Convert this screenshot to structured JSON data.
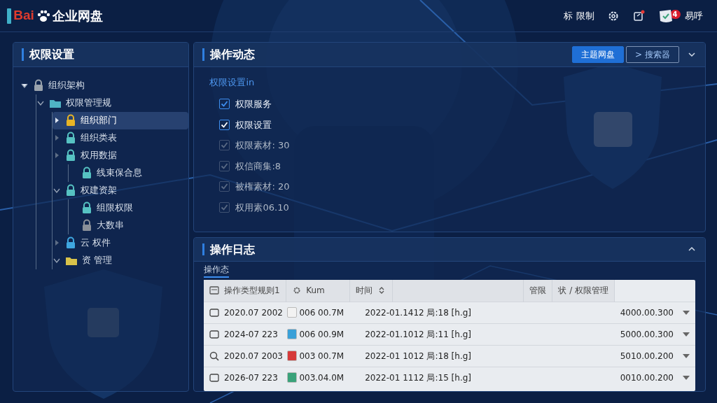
{
  "header": {
    "logo_text": "Bai",
    "product": "企业网盘",
    "links": [
      {
        "kind": "text",
        "label": "标 限制"
      },
      {
        "kind": "gear"
      },
      {
        "kind": "export"
      }
    ],
    "user": {
      "name": "易呼",
      "badge": "4"
    }
  },
  "sidebar": {
    "title": "权限设置",
    "tree": [
      {
        "label": "组织架构",
        "kind": "lock",
        "color": "#9aa3ad",
        "expanded": true,
        "selected": false,
        "children": [
          {
            "label": "权限管理规",
            "kind": "folder",
            "color": "#4fb3c4",
            "expanded": true,
            "selected": false,
            "children": [
              {
                "label": "组织部门",
                "kind": "lock",
                "color": "#e8b425",
                "expanded": false,
                "selected": true
              },
              {
                "label": "组织类表",
                "kind": "lock",
                "color": "#56c2c2",
                "expanded": false,
                "selected": false
              },
              {
                "label": "权用数据",
                "kind": "lock",
                "color": "#56c2c2",
                "expanded": false,
                "selected": false,
                "children": [
                  {
                    "label": "线束保合息",
                    "kind": "lock",
                    "color": "#56c2c2",
                    "selected": false
                  }
                ]
              },
              {
                "label": "权建资架",
                "kind": "lock",
                "color": "#56c2c2",
                "expanded": true,
                "selected": false,
                "children": [
                  {
                    "label": "组限权限",
                    "kind": "lock",
                    "color": "#56c2c2",
                    "selected": false
                  },
                  {
                    "label": "大数串",
                    "kind": "lock",
                    "color": "#8a9099",
                    "selected": false
                  }
                ]
              },
              {
                "label": "云 权件",
                "kind": "lock",
                "color": "#3fa7e0",
                "expanded": false,
                "selected": false
              },
              {
                "label": "资 管理",
                "kind": "folder",
                "color": "#d8c24a",
                "expanded": true,
                "selected": false
              }
            ]
          }
        ]
      }
    ]
  },
  "activity": {
    "title": "操作动态",
    "buttons": [
      {
        "label": "主题网盘",
        "kind": "primary"
      },
      {
        "label": "> 搜索器",
        "kind": "outline"
      }
    ],
    "subtitle": "权限设置in",
    "options": [
      {
        "label": "权限服务",
        "checked": true,
        "disabled": false
      },
      {
        "label": "权限设置",
        "checked": true,
        "disabled": false
      },
      {
        "label": "权限素材: 30",
        "checked": true,
        "disabled": true
      },
      {
        "label": "权信商集:8",
        "checked": true,
        "disabled": true
      },
      {
        "label": "被権素材: 20",
        "checked": true,
        "disabled": true
      },
      {
        "label": "权用素06.10",
        "checked": true,
        "disabled": true
      }
    ]
  },
  "log": {
    "title": "操作日志",
    "tabs": [
      {
        "label": "操作态",
        "selected": true
      }
    ],
    "columns": [
      "操作类型规则1",
      "Kum",
      "时间",
      "管限",
      "状 / 权限管理"
    ],
    "rows": [
      {
        "kind": "calendar",
        "date": "2020.07 2002",
        "color": "#f2f2f2",
        "size": "006 00.7M",
        "time": "2022-01.1412  局:18  [h.g]",
        "value": "4000.00.300"
      },
      {
        "kind": "calendar",
        "date": "2024-07 223",
        "color": "#3aa0d8",
        "size": "006 00.9M",
        "time": "2022-01.1012  局:11  [h.g]",
        "value": "5000.00.300"
      },
      {
        "kind": "search",
        "date": "2020.07 2003",
        "color": "#d63a3a",
        "size": "003 00.7M",
        "time": "2022-01 1012  局:18  [h.g]",
        "value": "5010.00.200"
      },
      {
        "kind": "calendar",
        "date": "2026-07 223",
        "color": "#3aa27a",
        "size": "003.04.0M",
        "time": "2022-01 1112  局:15  [h.g]",
        "value": "0010.00.200"
      }
    ]
  }
}
